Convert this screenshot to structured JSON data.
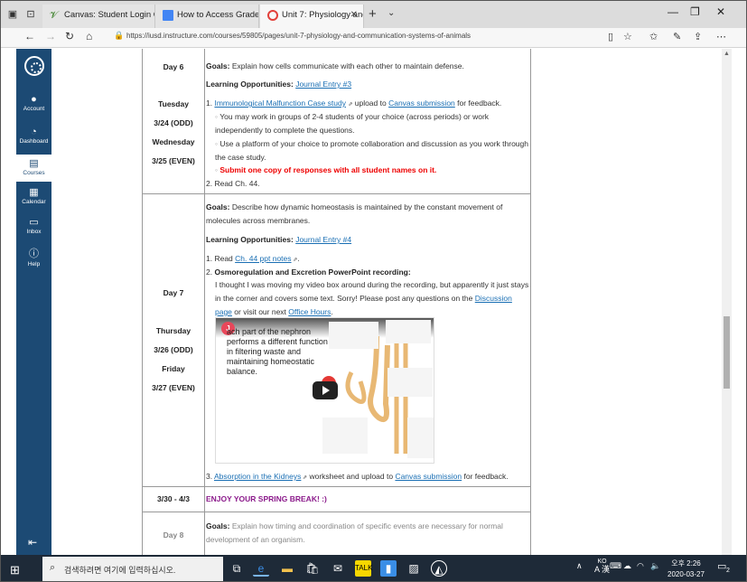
{
  "tabs": [
    {
      "label": "Canvas: Student Login Guid"
    },
    {
      "label": "How to Access Gradeslam a"
    },
    {
      "label": "Unit 7: Physiology and C"
    }
  ],
  "address": {
    "url": "https://iusd.instructure.com/courses/59805/pages/unit-7-physiology-and-communication-systems-of-animals"
  },
  "gnav": {
    "account": "Account",
    "dashboard": "Dashboard",
    "courses": "Courses",
    "calendar": "Calendar",
    "inbox": "Inbox",
    "help": "Help"
  },
  "day6": {
    "day": "Day 6",
    "date_lines": [
      "Tuesday",
      "3/24 (ODD)",
      "Wednesday",
      "3/25 (EVEN)"
    ],
    "goals_label": "Goals:",
    "goals_text": " Explain how cells communicate with each other to maintain defense.",
    "lo_label": "Learning Opportunities:",
    "lo_link": "Journal Entry #3",
    "item1_link": "Immunological Malfunction Case study",
    "item1_mid": " upload to ",
    "item1_link2": "Canvas submission",
    "item1_end": " for feedback.",
    "bullet1": "You may work in groups of 2-4 students of your choice (across periods) or work independently to complete the questions.",
    "bullet2": "Use a platform of your choice to promote collaboration and discussion as you work through the case study.",
    "bullet3": "Submit one copy of responses with all student names on it.",
    "item2": "Read Ch. 44."
  },
  "day7": {
    "day": "Day 7",
    "date_lines": [
      "Thursday",
      "3/26 (ODD)",
      "Friday",
      "3/27 (EVEN)"
    ],
    "goals_label": "Goals:",
    "goals_text": " Describe how dynamic homeostasis is maintained by the constant movement of molecules across membranes.",
    "lo_label": "Learning Opportunities:",
    "lo_link": "Journal Entry #4",
    "item1_pre": "Read ",
    "item1_link": "Ch. 44 ppt notes",
    "item1_end": ".",
    "item2_title": "Osmoregulation and Excretion PowerPoint recording:",
    "item2_text": "I thought I was moving my video box around during the recording, but apparently it just stays in the corner and covers some text. Sorry! Please post any questions on the ",
    "item2_link": "Discussion page",
    "item2_mid": " or visit our next ",
    "item2_link2": "Office Hours",
    "item2_end": ".",
    "video_title": "ach part of the nephron performs a different function in filtering waste and maintaining homeostatic balance.",
    "item3_link": "Absorption in the Kidneys",
    "item3_mid": " worksheet and upload to ",
    "item3_link2": "Canvas submission",
    "item3_end": " for feedback."
  },
  "break": {
    "dates": "3/30 - 4/3",
    "text": "ENJOY YOUR SPRING BREAK! :)"
  },
  "day8": {
    "day": "Day 8",
    "goals_label": "Goals:",
    "goals_text": " Explain how timing and coordination of specific events are necessary for normal development of an organism."
  },
  "taskbar": {
    "search_placeholder": "검색하려면 여기에 입력하십시오.",
    "ime_top": "KO",
    "ime_bottom": "A 漢",
    "time": "오후 2:26",
    "date": "2020-03-27",
    "notif_count": "2"
  }
}
